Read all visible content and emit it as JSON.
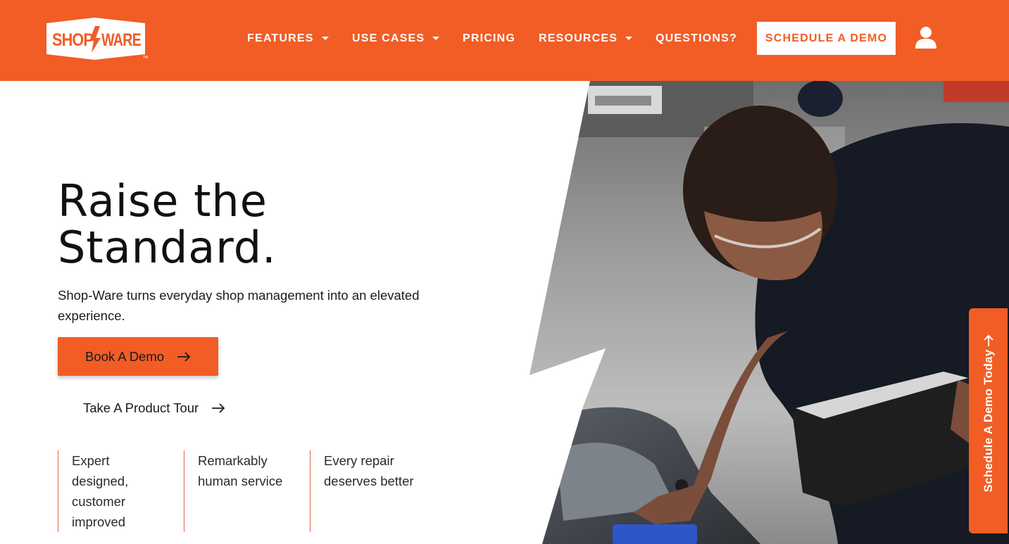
{
  "header": {
    "logo_text": "SHOP/WARE",
    "nav": [
      {
        "label": "FEATURES",
        "has_dropdown": true
      },
      {
        "label": "USE CASES",
        "has_dropdown": true
      },
      {
        "label": "PRICING",
        "has_dropdown": false
      },
      {
        "label": "RESOURCES",
        "has_dropdown": true
      },
      {
        "label": "QUESTIONS?",
        "has_dropdown": false
      }
    ],
    "cta_label": "SCHEDULE A DEMO",
    "account_icon": "user-icon"
  },
  "hero": {
    "headline_line1": "Raise the",
    "headline_line2": "Standard.",
    "subtext": "Shop-Ware turns everyday shop management into an elevated experience.",
    "primary_cta": "Book A Demo",
    "secondary_cta": "Take A Product Tour",
    "features": [
      {
        "text": "Expert designed, customer improved"
      },
      {
        "text": "Remarkably human service"
      },
      {
        "text": "Every repair deserves better"
      }
    ]
  },
  "side_tab": {
    "label": "Schedule A Demo Today"
  },
  "colors": {
    "brand_orange": "#f15d25",
    "text_dark": "#111111",
    "white": "#ffffff"
  }
}
